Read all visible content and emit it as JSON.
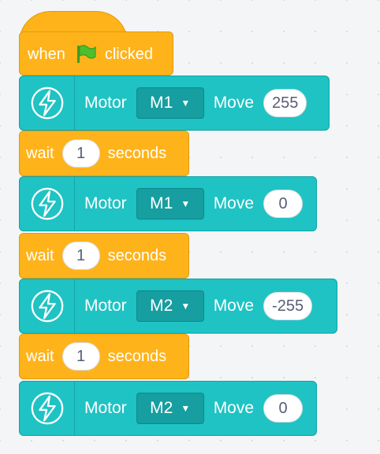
{
  "event": {
    "pre": "when",
    "post": "clicked",
    "flag_icon": "green-flag-icon",
    "color": "#ffb31a"
  },
  "blocks": [
    {
      "type": "motor",
      "label": "Motor",
      "motor": "M1",
      "action": "Move",
      "value": "255"
    },
    {
      "type": "wait",
      "pre": "wait",
      "value": "1",
      "post": "seconds"
    },
    {
      "type": "motor",
      "label": "Motor",
      "motor": "M1",
      "action": "Move",
      "value": "0"
    },
    {
      "type": "wait",
      "pre": "wait",
      "value": "1",
      "post": "seconds"
    },
    {
      "type": "motor",
      "label": "Motor",
      "motor": "M2",
      "action": "Move",
      "value": "-255"
    },
    {
      "type": "wait",
      "pre": "wait",
      "value": "1",
      "post": "seconds"
    },
    {
      "type": "motor",
      "label": "Motor",
      "motor": "M2",
      "action": "Move",
      "value": "0"
    }
  ],
  "colors": {
    "motor": "#1fc3c4",
    "wait": "#ffb31a",
    "dropdown": "#169ea0"
  },
  "icons": {
    "motor_icon": "lightning-bolt-icon",
    "caret": "dropdown-caret-icon"
  }
}
